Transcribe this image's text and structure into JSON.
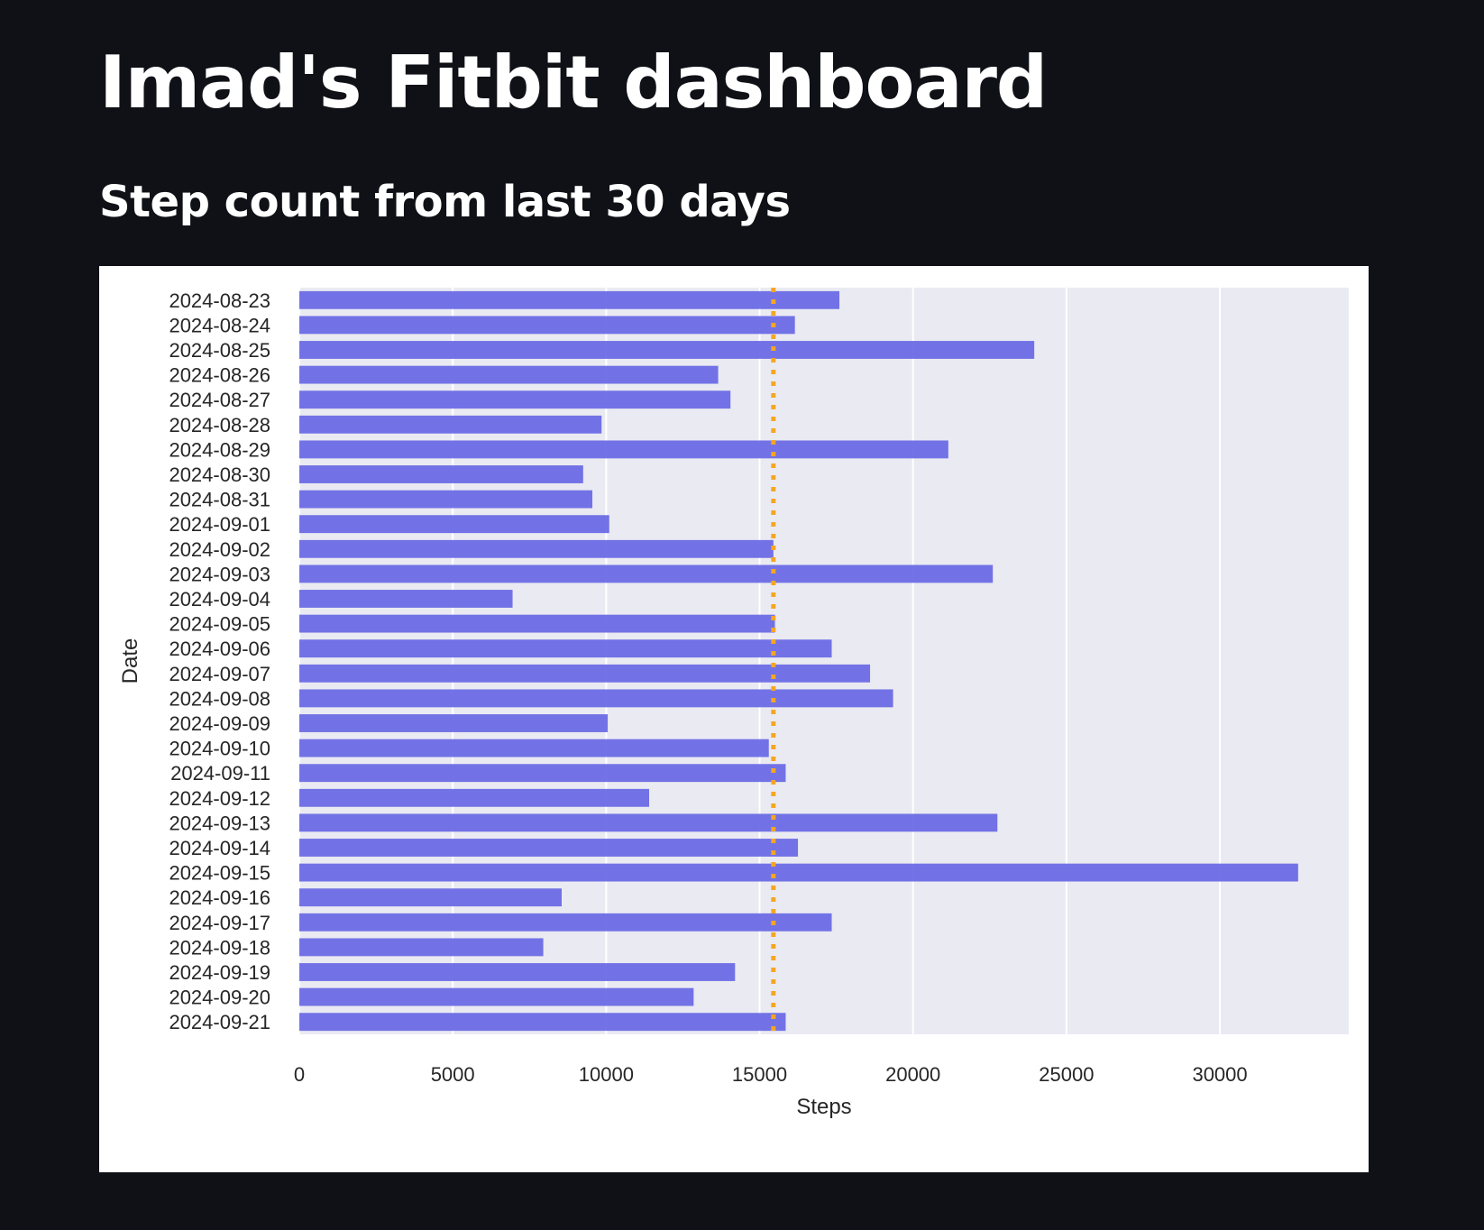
{
  "header": {
    "title": "Imad's Fitbit dashboard"
  },
  "section": {
    "title": "Step count from last 30 days"
  },
  "chart_data": {
    "type": "bar",
    "orientation": "horizontal",
    "title": "",
    "xlabel": "Steps",
    "ylabel": "Date",
    "xlim": [
      0,
      34200
    ],
    "x_ticks": [
      0,
      5000,
      10000,
      15000,
      20000,
      25000,
      30000
    ],
    "grid": true,
    "categories": [
      "2024-08-23",
      "2024-08-24",
      "2024-08-25",
      "2024-08-26",
      "2024-08-27",
      "2024-08-28",
      "2024-08-29",
      "2024-08-30",
      "2024-08-31",
      "2024-09-01",
      "2024-09-02",
      "2024-09-03",
      "2024-09-04",
      "2024-09-05",
      "2024-09-06",
      "2024-09-07",
      "2024-09-08",
      "2024-09-09",
      "2024-09-10",
      "2024-09-11",
      "2024-09-12",
      "2024-09-13",
      "2024-09-14",
      "2024-09-15",
      "2024-09-16",
      "2024-09-17",
      "2024-09-18",
      "2024-09-19",
      "2024-09-20",
      "2024-09-21"
    ],
    "values": [
      17600,
      16150,
      23950,
      13650,
      14050,
      9850,
      21150,
      9250,
      9550,
      10100,
      15450,
      22600,
      6950,
      15500,
      17350,
      18600,
      19350,
      10050,
      15300,
      15850,
      11400,
      22750,
      16250,
      32550,
      8550,
      17350,
      7950,
      14200,
      12850,
      15850
    ],
    "reference_line": {
      "value": 15450,
      "style": "dotted",
      "color": "#f5a623"
    },
    "colors": {
      "bar": "#6c6ce5",
      "plot_background": "#eaeaf2",
      "gridline": "#ffffff",
      "text": "#262626"
    }
  }
}
